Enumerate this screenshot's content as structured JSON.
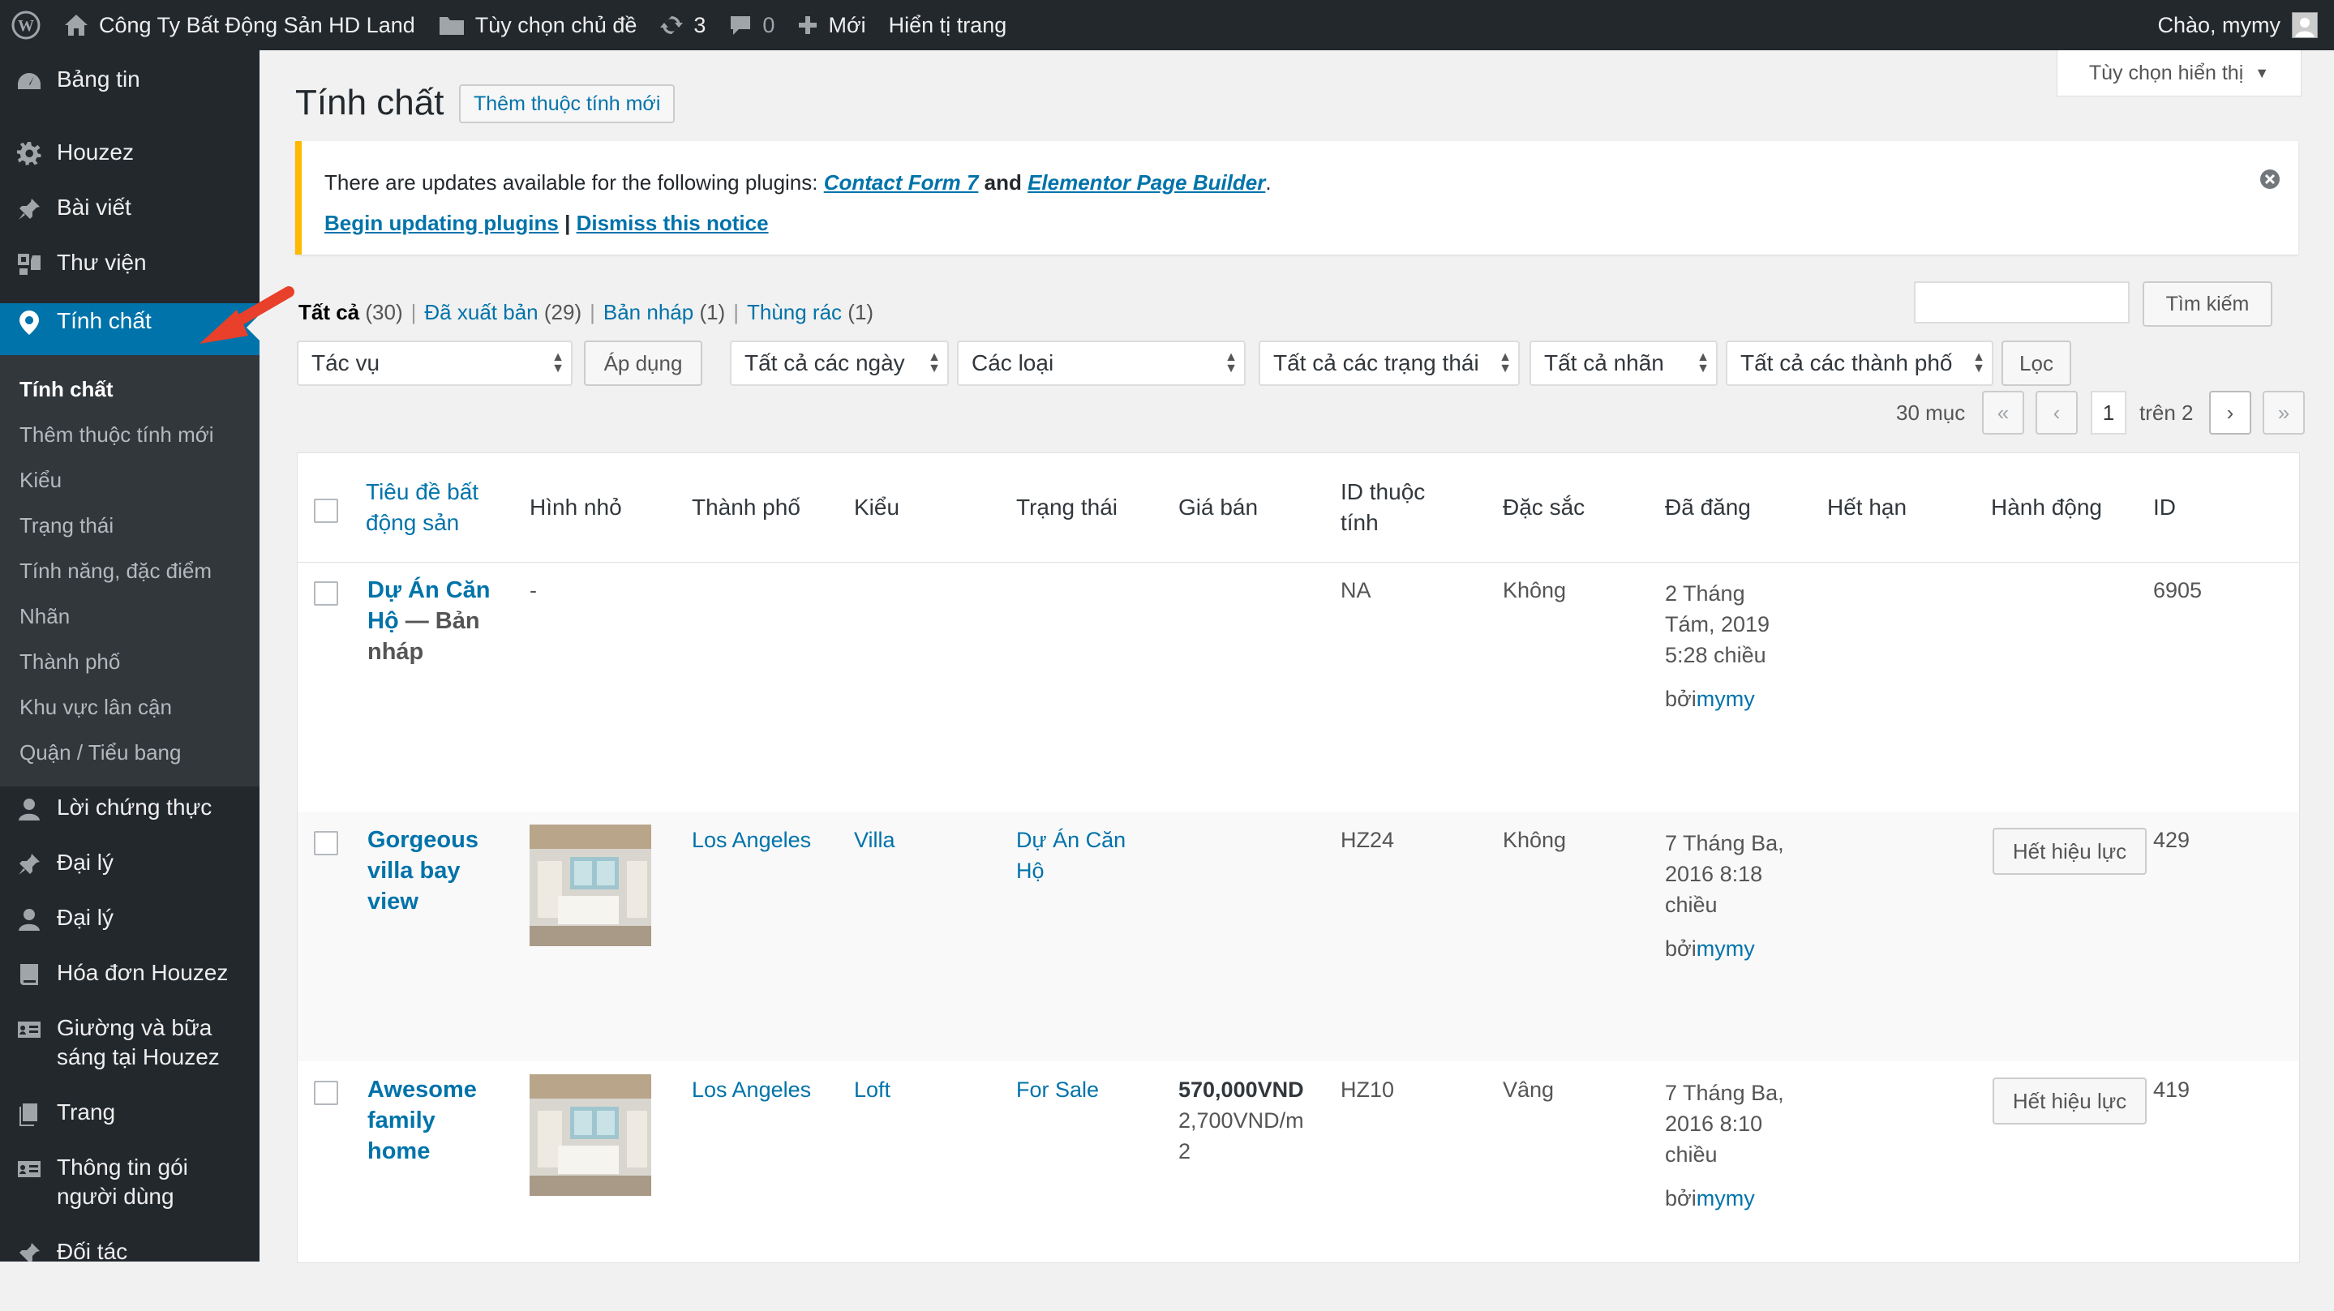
{
  "admin_bar": {
    "site_name": "Công Ty Bất Động Sản HD Land",
    "theme_options": "Tùy chọn chủ đề",
    "updates_count": "3",
    "comments_count": "0",
    "new_label": "Mới",
    "view_page": "Hiển tị trang",
    "greeting": "Chào, mymy"
  },
  "menu": {
    "dashboard": "Bảng tin",
    "houzez": "Houzez",
    "posts": "Bài viết",
    "media": "Thư viện",
    "properties": "Tính chất",
    "sub": [
      "Tính chất",
      "Thêm thuộc tính mới",
      "Kiểu",
      "Trạng thái",
      "Tính năng, đặc điểm",
      "Nhãn",
      "Thành phố",
      "Khu vực lân cận",
      "Quận / Tiểu bang"
    ],
    "testimonials": "Lời chứng thực",
    "agents1": "Đại lý",
    "agents2": "Đại lý",
    "invoices": "Hóa đơn Houzez",
    "bnb": "Giường và bữa sáng tại Houzez",
    "pages": "Trang",
    "packages": "Thông tin gói người dùng",
    "more": "Đối tác"
  },
  "screen_options": "Tùy chọn hiển thị",
  "page": {
    "title": "Tính chất",
    "add_new": "Thêm thuộc tính mới"
  },
  "notice": {
    "text_before": "There are updates available for the following plugins: ",
    "plugin1": "Contact Form 7",
    "and": " and ",
    "plugin2": "Elementor Page Builder",
    "period": ".",
    "begin": "Begin updating plugins",
    "sep": " | ",
    "dismiss": "Dismiss this notice"
  },
  "filters": {
    "all": "Tất cả",
    "all_count": "(30)",
    "published": "Đã xuất bản",
    "published_count": "(29)",
    "draft": "Bản nháp",
    "draft_count": "(1)",
    "trash": "Thùng rác",
    "trash_count": "(1)",
    "search_button": "Tìm kiếm",
    "bulk_action": "Tác vụ",
    "apply": "Áp dụng",
    "dates": "Tất cả các ngày",
    "types": "Các loại",
    "statuses": "Tất cả các trạng thái",
    "labels": "Tất cả nhãn",
    "cities": "Tất cả các thành phố",
    "filter_button": "Lọc"
  },
  "pagination": {
    "items": "30 mục",
    "first": "«",
    "prev": "‹",
    "current": "1",
    "of": "trên 2",
    "next": "›",
    "last": "»"
  },
  "columns": {
    "title": "Tiêu đề bất động sản",
    "thumb": "Hình nhỏ",
    "city": "Thành phố",
    "type": "Kiểu",
    "status": "Trạng thái",
    "price": "Giá bán",
    "prop_id": "ID thuộc tính",
    "featured": "Đặc sắc",
    "date": "Đã đăng",
    "expiry": "Hết hạn",
    "actions": "Hành động",
    "id": "ID"
  },
  "rows": [
    {
      "title": "Dự Án Căn Hộ",
      "state": " — Bản nháp",
      "thumb": "-",
      "city": "",
      "type": "",
      "status": "",
      "price": "",
      "price2": "",
      "prop_id": "NA",
      "featured": "Không",
      "date": "2 Tháng Tám, 2019 5:28 chiều",
      "by": "bởi",
      "author": "mymy",
      "expiry": "",
      "action": "",
      "id": "6905"
    },
    {
      "title": "Gorgeous villa bay view",
      "state": "",
      "thumb": "",
      "city": "Los Angeles",
      "type": "Villa",
      "status": "Dự Án Căn Hộ",
      "price": "",
      "price2": "",
      "prop_id": "HZ24",
      "featured": "Không",
      "date": "7 Tháng Ba, 2016 8:18 chiều",
      "by": "bởi",
      "author": "mymy",
      "expiry": "",
      "action": "Hết hiệu lực",
      "id": "429"
    },
    {
      "title": "Awesome family home",
      "state": "",
      "thumb": "",
      "city": "Los Angeles",
      "type": "Loft",
      "status": "For Sale",
      "price": "570,000VND",
      "price2": "2,700VND/m2",
      "prop_id": "HZ10",
      "featured": "Vâng",
      "date": "7 Tháng Ba, 2016 8:10 chiều",
      "by": "bởi",
      "author": "mymy",
      "expiry": "",
      "action": "Hết hiệu lực",
      "id": "419"
    }
  ],
  "colors": {
    "accent": "#0073aa",
    "menu_bg": "#23282d",
    "notice": "#ffb900",
    "arrow": "#e8402a"
  }
}
